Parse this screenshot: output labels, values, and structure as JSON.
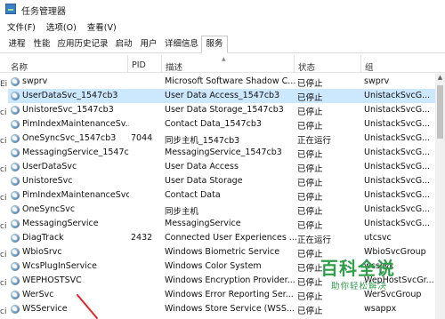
{
  "window": {
    "title": "任务管理器"
  },
  "menu": [
    "文件(F)",
    "选项(O)",
    "查看(V)"
  ],
  "tabs": [
    "进程",
    "性能",
    "应用历史记录",
    "启动",
    "用户",
    "详细信息",
    "服务"
  ],
  "active_tab": "服务",
  "columns": [
    "名称",
    "PID",
    "描述",
    "状态",
    "组"
  ],
  "left_strip_chars": [
    "Ei",
    "ci",
    "ci",
    "ci",
    "ci",
    "ci",
    "ci",
    "ci",
    "ci"
  ],
  "services": [
    {
      "name": "swprv",
      "pid": "",
      "desc": "Microsoft Software Shadow C...",
      "status": "已停止",
      "group": "swprv",
      "selected": false
    },
    {
      "name": "UserDataSvc_1547cb3",
      "pid": "",
      "desc": "User Data Access_1547cb3",
      "status": "已停止",
      "group": "UnistackSvcG...",
      "selected": true
    },
    {
      "name": "UnistoreSvc_1547cb3",
      "pid": "",
      "desc": "User Data Storage_1547cb3",
      "status": "已停止",
      "group": "UnistackSvcG...",
      "selected": false
    },
    {
      "name": "PimIndexMaintenanceSv...",
      "pid": "",
      "desc": "Contact Data_1547cb3",
      "status": "已停止",
      "group": "UnistackSvcG...",
      "selected": false
    },
    {
      "name": "OneSyncSvc_1547cb3",
      "pid": "7044",
      "desc": "同步主机_1547cb3",
      "status": "正在运行",
      "group": "UnistackSvcG...",
      "selected": false
    },
    {
      "name": "MessagingService_1547c...",
      "pid": "",
      "desc": "MessagingService_1547cb3",
      "status": "已停止",
      "group": "UnistackSvcG...",
      "selected": false
    },
    {
      "name": "UserDataSvc",
      "pid": "",
      "desc": "User Data Access",
      "status": "已停止",
      "group": "UnistackSvcG...",
      "selected": false
    },
    {
      "name": "UnistoreSvc",
      "pid": "",
      "desc": "User Data Storage",
      "status": "已停止",
      "group": "UnistackSvcG...",
      "selected": false
    },
    {
      "name": "PimIndexMaintenanceSvc",
      "pid": "",
      "desc": "Contact Data",
      "status": "已停止",
      "group": "UnistackSvcG...",
      "selected": false
    },
    {
      "name": "OneSyncSvc",
      "pid": "",
      "desc": "同步主机",
      "status": "已停止",
      "group": "UnistackSvcG...",
      "selected": false
    },
    {
      "name": "MessagingService",
      "pid": "",
      "desc": "MessagingService",
      "status": "已停止",
      "group": "UnistackSvcG...",
      "selected": false
    },
    {
      "name": "DiagTrack",
      "pid": "2432",
      "desc": "Connected User Experiences ...",
      "status": "正在运行",
      "group": "utcsvc",
      "selected": false
    },
    {
      "name": "WbioSrvc",
      "pid": "",
      "desc": "Windows Biometric Service",
      "status": "已停止",
      "group": "WbioSvcGroup",
      "selected": false
    },
    {
      "name": "WcsPlugInService",
      "pid": "",
      "desc": "Windows Color System",
      "status": "已停止",
      "group": "wcssvc",
      "selected": false
    },
    {
      "name": "WEPHOSTSVC",
      "pid": "",
      "desc": "Windows Encryption Provider...",
      "status": "已停止",
      "group": "WepHostSvcGr...",
      "selected": false
    },
    {
      "name": "WerSvc",
      "pid": "",
      "desc": "Windows Error Reporting Ser...",
      "status": "已停止",
      "group": "WerSvcGroup",
      "selected": false
    },
    {
      "name": "WSService",
      "pid": "",
      "desc": "Windows Store Service (WSS...",
      "status": "已停止",
      "group": "wsappx",
      "selected": false
    }
  ],
  "watermark": {
    "title": "百科全说",
    "subtitle": "助你轻松解决"
  },
  "colors": {
    "selected_row": "#cce8ff",
    "watermark_green": "#2e9e4a",
    "arrow_red": "#e0262a"
  },
  "icons": {
    "app": "task-manager-icon",
    "service": "gear-service-icon",
    "scroll_up": "chevron-up-icon"
  }
}
